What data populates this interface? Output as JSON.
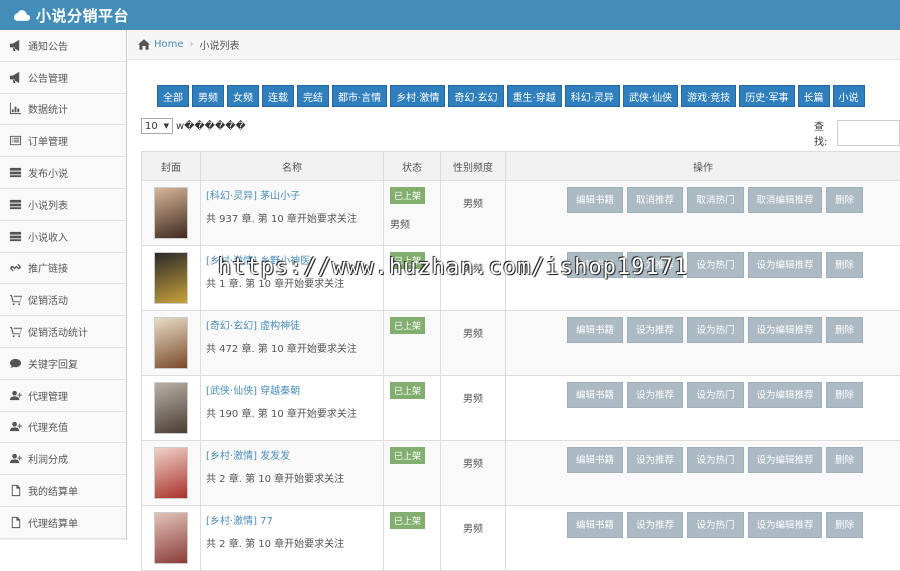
{
  "app": {
    "title": "小说分销平台"
  },
  "sidebar": {
    "items": [
      {
        "label": "通知公告",
        "icon": "bullhorn-icon"
      },
      {
        "label": "公告管理",
        "icon": "bullhorn-icon"
      },
      {
        "label": "数据统计",
        "icon": "bar-chart-icon"
      },
      {
        "label": "订单管理",
        "icon": "list-alt-icon"
      },
      {
        "label": "发布小说",
        "icon": "server-icon"
      },
      {
        "label": "小说列表",
        "icon": "server-icon"
      },
      {
        "label": "小说收入",
        "icon": "server-icon"
      },
      {
        "label": "推广链接",
        "icon": "link-icon"
      },
      {
        "label": "促销活动",
        "icon": "cart-icon"
      },
      {
        "label": "促销活动统计",
        "icon": "cart-icon"
      },
      {
        "label": "关键字回复",
        "icon": "comment-icon"
      },
      {
        "label": "代理管理",
        "icon": "user-plus-icon"
      },
      {
        "label": "代理充值",
        "icon": "user-plus-icon"
      },
      {
        "label": "利润分成",
        "icon": "user-plus-icon"
      },
      {
        "label": "我的结算单",
        "icon": "file-icon"
      },
      {
        "label": "代理结算单",
        "icon": "file-icon"
      }
    ]
  },
  "breadcrumb": {
    "home": "Home",
    "current": "小说列表"
  },
  "filters": [
    "全部",
    "男频",
    "女频",
    "连载",
    "完结",
    "都市·言情",
    "乡村·激情",
    "奇幻·玄幻",
    "重生·穿越",
    "科幻·灵异",
    "武侠·仙侠",
    "游戏·竞技",
    "历史·军事",
    "长篇",
    "小说"
  ],
  "pagesize": {
    "value": "10",
    "suffix": "w������"
  },
  "search": {
    "label": "查找:"
  },
  "table": {
    "headers": {
      "cover": "封面",
      "name": "名称",
      "status": "状态",
      "gender": "性别频度",
      "ops": "操作"
    },
    "rows": [
      {
        "title": "[科幻·灵异] 茅山小子",
        "meta": "共 937 章. 第 10 章开始要求关注",
        "status": "已上架",
        "channel": "男频",
        "gender": "男频",
        "ops": [
          "编辑书籍",
          "取消推荐",
          "取消热门",
          "取消编辑推荐",
          "删除"
        ],
        "cover": [
          "#d8b69a",
          "#3e2a1e"
        ]
      },
      {
        "title": "[乡村·激情] 乡野小神医",
        "meta": "共 1 章. 第 10 章开始要求关注",
        "status": "已上架",
        "channel": "",
        "gender": "男频",
        "ops": [
          "编辑书籍",
          "设为推荐",
          "设为热门",
          "设为编辑推荐",
          "删除"
        ],
        "cover": [
          "#2a2a2a",
          "#c9a23c"
        ]
      },
      {
        "title": "[奇幻·玄幻] 虚构神徒",
        "meta": "共 472 章. 第 10 章开始要求关注",
        "status": "已上架",
        "channel": "",
        "gender": "男频",
        "ops": [
          "编辑书籍",
          "设为推荐",
          "设为热门",
          "设为编辑推荐",
          "删除"
        ],
        "cover": [
          "#e8ddc8",
          "#7a4a2a"
        ]
      },
      {
        "title": "[武侠·仙侠] 穿越秦朝",
        "meta": "共 190 章. 第 10 章开始要求关注",
        "status": "已上架",
        "channel": "",
        "gender": "男频",
        "ops": [
          "编辑书籍",
          "设为推荐",
          "设为热门",
          "设为编辑推荐",
          "删除"
        ],
        "cover": [
          "#b9b1a6",
          "#4a3d32"
        ]
      },
      {
        "title": "[乡村·激情] 发发发",
        "meta": "共 2 章. 第 10 章开始要求关注",
        "status": "已上架",
        "channel": "",
        "gender": "男频",
        "ops": [
          "编辑书籍",
          "设为推荐",
          "设为热门",
          "设为编辑推荐",
          "删除"
        ],
        "cover": [
          "#f0d2c8",
          "#a8322c"
        ]
      },
      {
        "title": "[乡村·激情] 77",
        "meta": "共 2 章. 第 10 章开始要求关注",
        "status": "已上架",
        "channel": "",
        "gender": "男频",
        "ops": [
          "编辑书籍",
          "设为推荐",
          "设为热门",
          "设为编辑推荐",
          "删除"
        ],
        "cover": [
          "#e2c4b8",
          "#8b3b38"
        ]
      }
    ]
  },
  "watermark": "https://www.huzhan.com/ishop19171",
  "colors": {
    "topbar": "#438eb9",
    "filter_button": "#2f7ebd",
    "badge": "#82af6f",
    "op_button": "#abbac3"
  }
}
